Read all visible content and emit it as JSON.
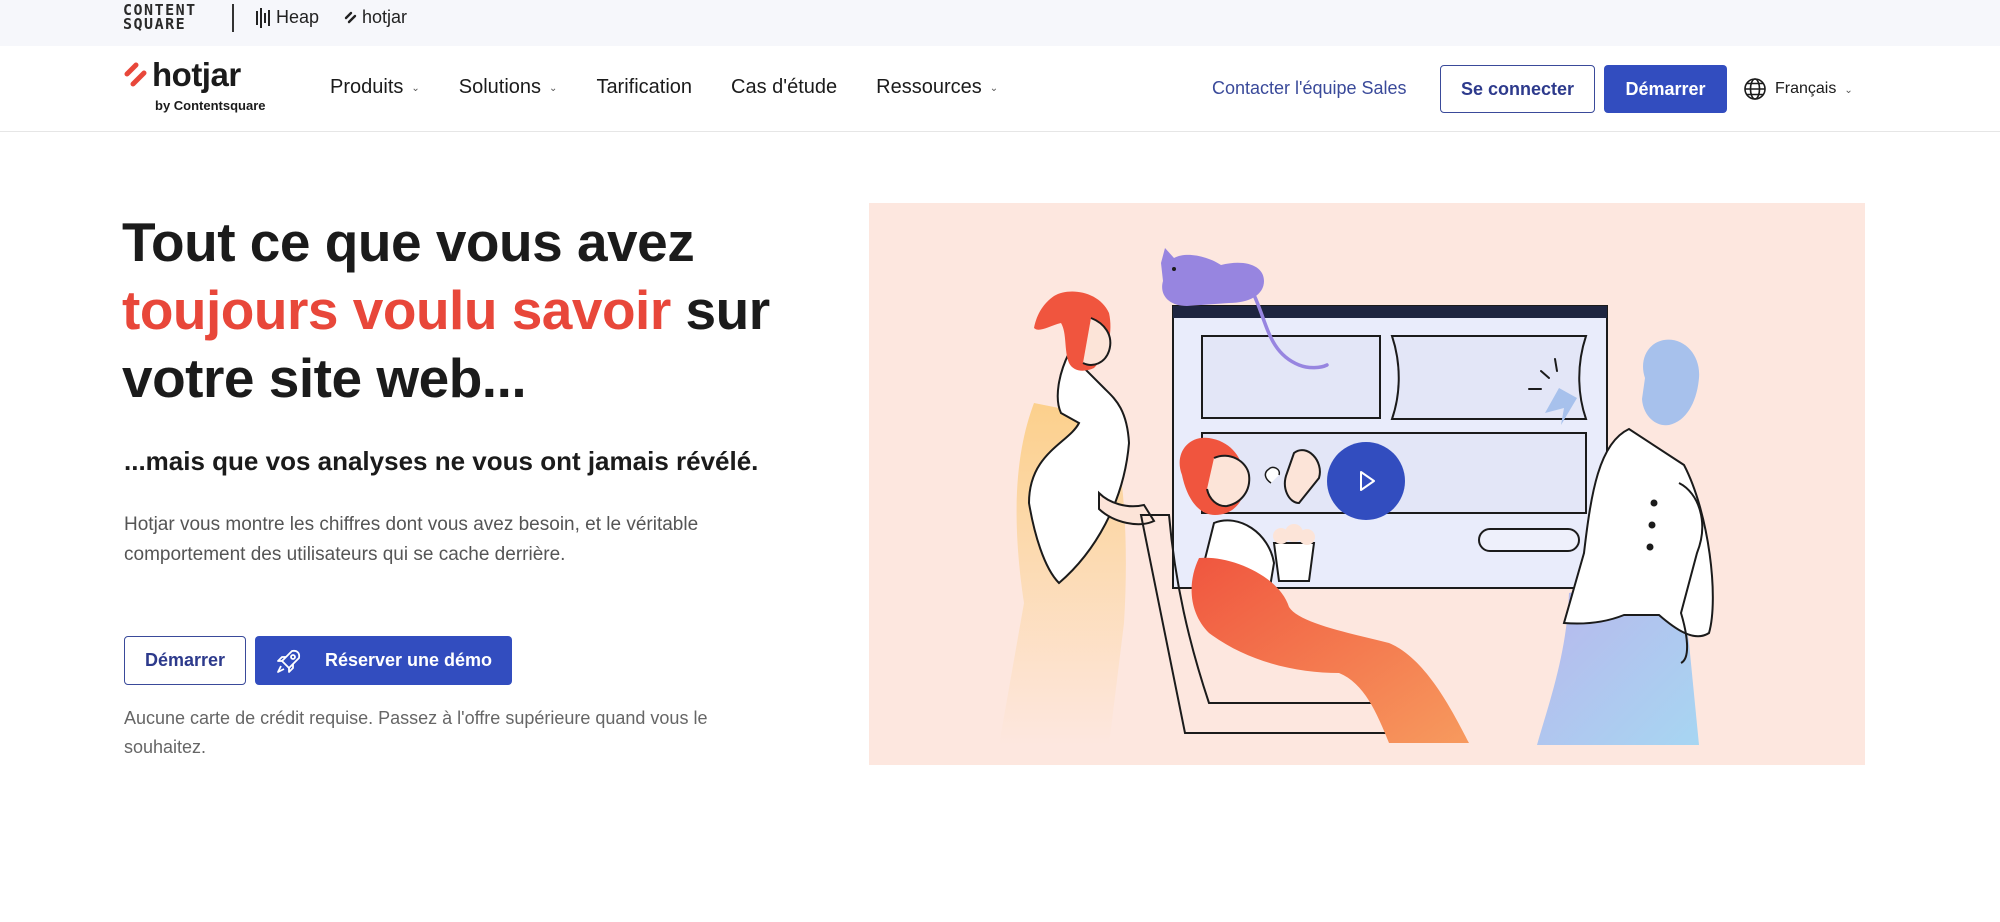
{
  "brand_bar": {
    "contentsquare_line1": "CONTENT",
    "contentsquare_line2": "SQUARE",
    "heap": "Heap",
    "hotjar": "hotjar"
  },
  "nav": {
    "logo_word": "hotjar",
    "logo_sub": "by Contentsquare",
    "items": [
      {
        "label": "Produits",
        "dropdown": true
      },
      {
        "label": "Solutions",
        "dropdown": true
      },
      {
        "label": "Tarification",
        "dropdown": false
      },
      {
        "label": "Cas d'étude",
        "dropdown": false
      },
      {
        "label": "Ressources",
        "dropdown": true
      }
    ],
    "contact_sales": "Contacter l'équipe Sales",
    "login": "Se connecter",
    "start": "Démarrer",
    "language": "Français"
  },
  "hero": {
    "title_part1": "Tout ce que vous avez",
    "title_accent": "toujours voulu savoir",
    "title_part2": " sur",
    "title_part3": "votre site web...",
    "subtitle": "...mais que vos analyses ne vous ont jamais révélé.",
    "body": "Hotjar vous montre les chiffres dont vous avez besoin, et le véritable comportement des utilisateurs qui se cache derrière.",
    "btn_start": "Démarrer",
    "btn_demo": "Réserver une démo",
    "footnote": "Aucune carte de crédit requise. Passez à l'offre supérieure quand vous le souhaitez."
  },
  "colors": {
    "accent_red": "#e8473a",
    "primary_blue": "#324dbf",
    "illustration_bg": "#fde7df"
  },
  "icons": [
    "hotjar-logo-icon",
    "heap-logo-icon",
    "chevron-down-icon",
    "globe-icon",
    "rocket-icon",
    "play-icon"
  ]
}
